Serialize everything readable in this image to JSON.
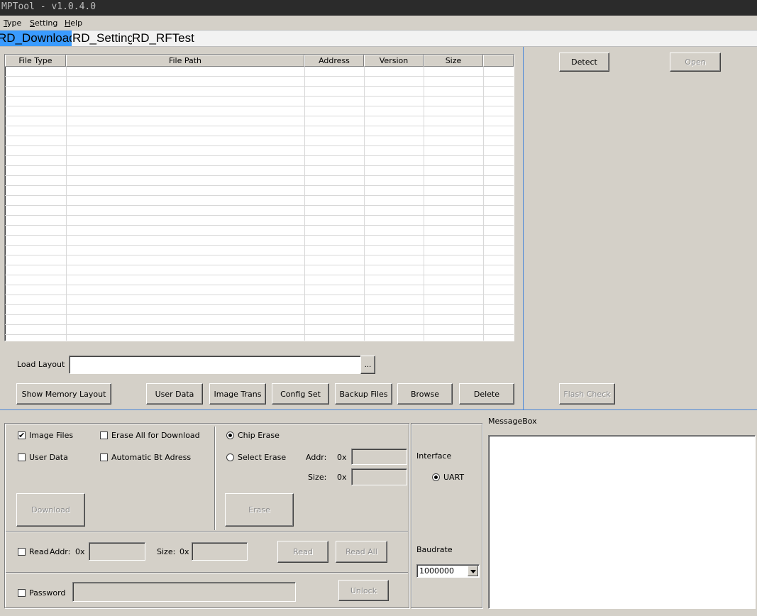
{
  "window": {
    "title": "MPTool - v1.0.4.0"
  },
  "menu": {
    "items": [
      {
        "label": "Type"
      },
      {
        "label": "Setting"
      },
      {
        "label": "Help"
      }
    ]
  },
  "tabs": [
    {
      "label": "RD_Download",
      "active": true
    },
    {
      "label": "RD_Setting",
      "active": false
    },
    {
      "label": "RD_RFTest",
      "active": false
    }
  ],
  "table": {
    "columns": [
      "File Type",
      "File Path",
      "Address",
      "Version",
      "Size",
      ""
    ]
  },
  "right_panel": {
    "detect_label": "Detect",
    "open_label": "Open",
    "flash_check_label": "Flash Check"
  },
  "layout_row": {
    "load_layout_label": "Load Layout",
    "load_layout_value": "",
    "browse_dots": "..."
  },
  "toolbar": {
    "show_memory_layout": "Show Memory Layout",
    "user_data": "User Data",
    "image_trans": "Image Trans",
    "config_set": "Config Set",
    "backup_files": "Backup Files",
    "browse": "Browse",
    "delete": "Delete"
  },
  "download_group": {
    "image_files_label": "Image Files",
    "image_files_checked": true,
    "erase_all_label": "Erase All for Download",
    "user_data_label": "User Data",
    "auto_bt_label": "Automatic Bt Adress",
    "download_label": "Download"
  },
  "erase_group": {
    "chip_erase_label": "Chip Erase",
    "select_erase_label": "Select Erase",
    "addr_label": "Addr:",
    "size_label": "Size:",
    "hex_prefix": "0x",
    "erase_label": "Erase"
  },
  "read_row": {
    "read_label": "Read",
    "addr_label": "Addr:",
    "hex_prefix": "0x",
    "size_label": "Size:",
    "read_button": "Read",
    "read_all_button": "Read All"
  },
  "password_row": {
    "password_label": "Password",
    "unlock_label": "Unlock"
  },
  "interface": {
    "interface_label": "Interface",
    "uart_label": "UART",
    "baudrate_label": "Baudrate",
    "baudrate_value": "1000000"
  },
  "messagebox": {
    "label": "MessageBox"
  }
}
